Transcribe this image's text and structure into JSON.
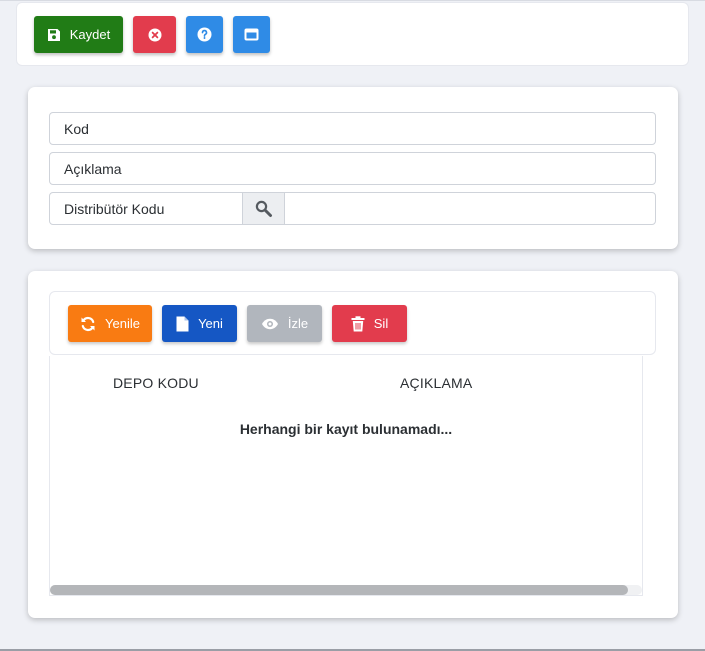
{
  "toolbar": {
    "save_label": "Kaydet",
    "icons": [
      "save-icon",
      "cancel-icon",
      "help-icon",
      "window-icon"
    ],
    "colors": {
      "save": "#217c16",
      "cancel": "#e23c4d",
      "help": "#2f8be6",
      "window": "#2f8be6"
    }
  },
  "form": {
    "kod_label": "Kod",
    "aciklama_label": "Açıklama",
    "distributor_label": "Distribütör Kodu",
    "distributor_value": ""
  },
  "list": {
    "buttons": {
      "refresh": "Yenile",
      "new": "Yeni",
      "view": "İzle",
      "delete": "Sil"
    },
    "colors": {
      "refresh": "#f97b12",
      "new": "#1557c4",
      "view": "#b1b6bd",
      "delete": "#e23c4d"
    },
    "columns": [
      "DEPO KODU",
      "AÇIKLAMA"
    ],
    "empty_message": "Herhangi bir kayıt bulunamadı..."
  }
}
